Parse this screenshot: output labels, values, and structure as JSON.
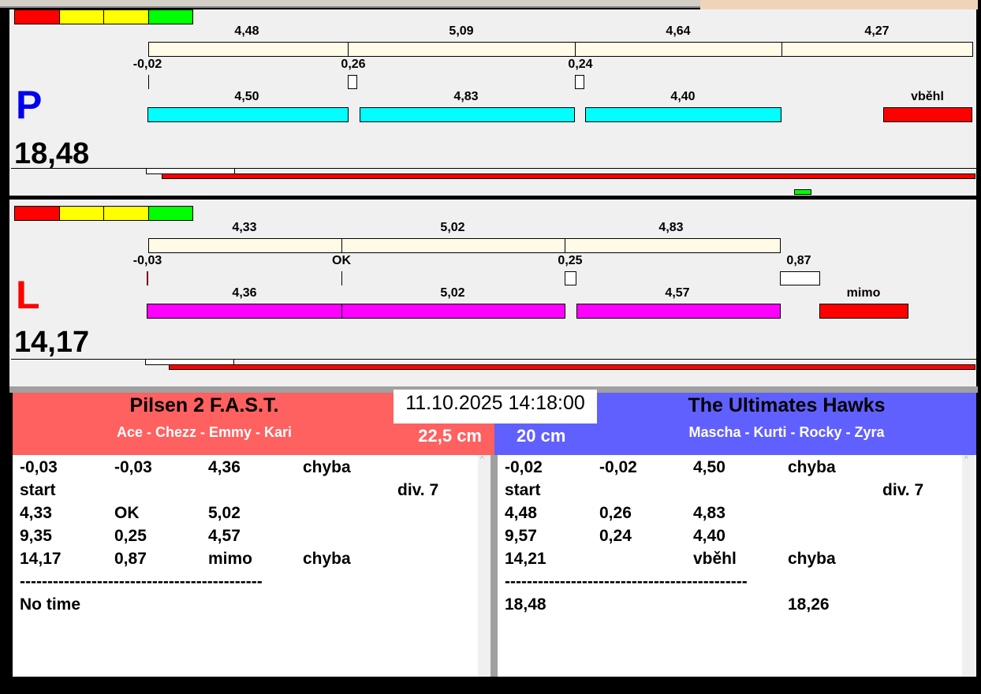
{
  "colors": {
    "red": "#ff0000",
    "yellow": "#ffff00",
    "green": "#00ff00",
    "cream": "#fffbe6",
    "cyan": "#00ffff",
    "magenta": "#ff00ff",
    "team_left": "#ff6060",
    "team_right": "#6060ff"
  },
  "lane_p": {
    "letter": "P",
    "total": "18,48",
    "top_labels": [
      "4,48",
      "5,09",
      "4,64",
      "4,27"
    ],
    "offsets": [
      "-0,02",
      "0,26",
      "0,24"
    ],
    "mid_labels": [
      "4,50",
      "4,83",
      "4,40",
      "vběhl"
    ]
  },
  "lane_l": {
    "letter": "L",
    "total": "14,17",
    "top_labels": [
      "4,33",
      "5,02",
      "4,83"
    ],
    "offsets": [
      "-0,03",
      "OK",
      "0,25",
      "0,87"
    ],
    "mid_labels": [
      "4,36",
      "5,02",
      "4,57",
      "mimo"
    ]
  },
  "datetime": "11.10.2025 14:18:00",
  "left_team": {
    "name": "Pilsen 2 F.A.S.T.",
    "dogs": "Ace - Chezz - Emmy - Kari",
    "height": "22,5 cm",
    "rows": [
      [
        "-0,03",
        "-0,03",
        "4,36",
        "chyba",
        ""
      ],
      [
        "start",
        "",
        "",
        "",
        "div.  7"
      ],
      [
        "4,33",
        "OK",
        "5,02",
        "",
        ""
      ],
      [
        "9,35",
        "0,25",
        "4,57",
        "",
        ""
      ],
      [
        "14,17",
        "0,87",
        "mimo",
        "chyba",
        ""
      ],
      [
        "--------------------------------------------",
        "",
        "",
        "",
        ""
      ],
      [
        "No time",
        "",
        "",
        "",
        ""
      ]
    ]
  },
  "right_team": {
    "name": "The Ultimates Hawks",
    "dogs": "Mascha - Kurti - Rocky - Zyra",
    "height": "20 cm",
    "rows": [
      [
        "-0,02",
        "-0,02",
        "4,50",
        "chyba",
        ""
      ],
      [
        "start",
        "",
        "",
        "",
        "div.  7"
      ],
      [
        "4,48",
        "0,26",
        "4,83",
        "",
        ""
      ],
      [
        "9,57",
        "0,24",
        "4,40",
        "",
        ""
      ],
      [
        "14,21",
        "",
        "vběhl",
        "chyba",
        ""
      ],
      [
        "--------------------------------------------",
        "",
        "",
        "",
        ""
      ],
      [
        "18,48",
        "",
        "",
        "18,26",
        ""
      ]
    ]
  }
}
